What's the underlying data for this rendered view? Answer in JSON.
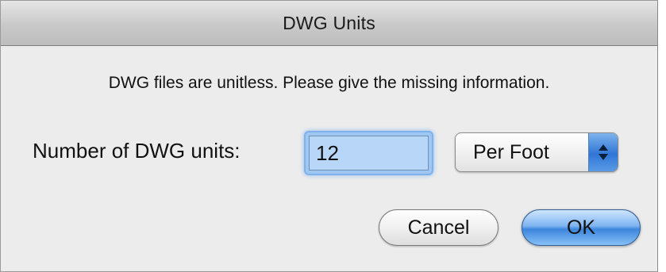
{
  "window": {
    "title": "DWG Units"
  },
  "message": "DWG files are unitless. Please give the missing information.",
  "units_field": {
    "label": "Number of DWG units:",
    "value": "12"
  },
  "unit_select": {
    "selected": "Per Foot"
  },
  "buttons": {
    "cancel_label": "Cancel",
    "ok_label": "OK"
  },
  "colors": {
    "accent": "#3d86dd",
    "window_bg": "#ececec",
    "input_focus": "#9fc7f3"
  }
}
